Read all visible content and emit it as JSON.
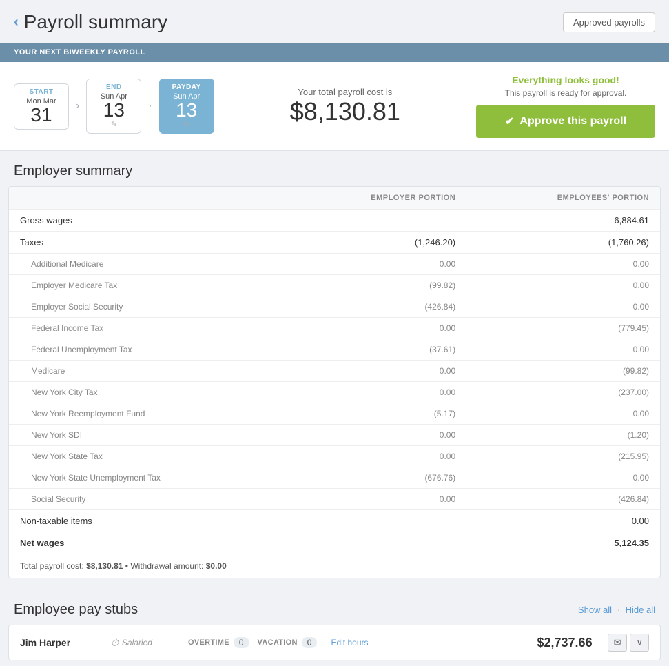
{
  "header": {
    "back_label": "‹",
    "title": "Payroll summary",
    "approved_payrolls_btn": "Approved payrolls"
  },
  "banner": {
    "text": "YOUR NEXT BIWEEKLY PAYROLL"
  },
  "dates": {
    "start": {
      "label": "START",
      "line1": "Mon Mar",
      "day": "31"
    },
    "end": {
      "label": "END",
      "line1": "Sun Apr",
      "day": "13"
    },
    "payday": {
      "label": "PAYDAY",
      "line1": "Sun Apr",
      "day": "13"
    }
  },
  "total_cost": {
    "label": "Your total payroll cost is",
    "value": "$8,130.81"
  },
  "approve": {
    "everything_good": "Everything looks good!",
    "ready_text": "This payroll is ready for approval.",
    "btn_label": "Approve this payroll"
  },
  "employer_summary": {
    "section_title": "Employer summary",
    "col_employer": "EMPLOYER PORTION",
    "col_employees": "EMPLOYEES' PORTION",
    "rows": [
      {
        "label": "Gross wages",
        "employer": "",
        "employees": "6,884.61",
        "type": "main"
      },
      {
        "label": "Taxes",
        "employer": "(1,246.20)",
        "employees": "(1,760.26)",
        "type": "main"
      },
      {
        "label": "Additional Medicare",
        "employer": "0.00",
        "employees": "0.00",
        "type": "sub"
      },
      {
        "label": "Employer Medicare Tax",
        "employer": "(99.82)",
        "employees": "0.00",
        "type": "sub"
      },
      {
        "label": "Employer Social Security",
        "employer": "(426.84)",
        "employees": "0.00",
        "type": "sub"
      },
      {
        "label": "Federal Income Tax",
        "employer": "0.00",
        "employees": "(779.45)",
        "type": "sub"
      },
      {
        "label": "Federal Unemployment Tax",
        "employer": "(37.61)",
        "employees": "0.00",
        "type": "sub"
      },
      {
        "label": "Medicare",
        "employer": "0.00",
        "employees": "(99.82)",
        "type": "sub"
      },
      {
        "label": "New York City Tax",
        "employer": "0.00",
        "employees": "(237.00)",
        "type": "sub"
      },
      {
        "label": "New York Reemployment Fund",
        "employer": "(5.17)",
        "employees": "0.00",
        "type": "sub"
      },
      {
        "label": "New York SDI",
        "employer": "0.00",
        "employees": "(1.20)",
        "type": "sub"
      },
      {
        "label": "New York State Tax",
        "employer": "0.00",
        "employees": "(215.95)",
        "type": "sub"
      },
      {
        "label": "New York State Unemployment Tax",
        "employer": "(676.76)",
        "employees": "0.00",
        "type": "sub"
      },
      {
        "label": "Social Security",
        "employer": "0.00",
        "employees": "(426.84)",
        "type": "sub"
      },
      {
        "label": "Non-taxable items",
        "employer": "",
        "employees": "0.00",
        "type": "main"
      },
      {
        "label": "Net wages",
        "employer": "",
        "employees": "5,124.35",
        "type": "net"
      }
    ],
    "footer": {
      "total_label": "Total payroll cost:",
      "total_value": "$8,130.81",
      "separator": "•",
      "withdrawal_label": "Withdrawal amount:",
      "withdrawal_value": "$0.00"
    }
  },
  "employee_pay_stubs": {
    "section_title": "Employee pay stubs",
    "show_all": "Show all",
    "hide_all": "Hide all",
    "employees": [
      {
        "name": "Jim Harper",
        "type": "Salaried",
        "overtime_label": "OVERTIME",
        "overtime_value": "0",
        "vacation_label": "VACATION",
        "vacation_value": "0",
        "edit_hours": "Edit hours",
        "amount": "$2,737.66"
      }
    ]
  }
}
